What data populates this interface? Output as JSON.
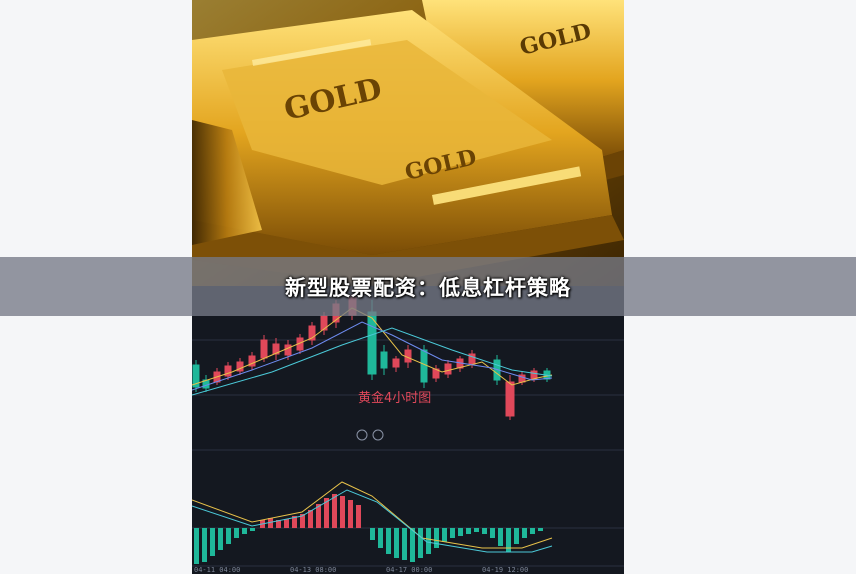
{
  "article": {
    "title": "新型股票配资：低息杠杆策略"
  },
  "image": {
    "bar_top_text": "GOLD",
    "bar_top_text_2": "GOLD",
    "bar_mid_text": "GOLD",
    "chart_caption": "黄金4小时图",
    "time_labels": [
      "04-11 04:00",
      "04-13 08:00",
      "04-17 00:00",
      "04-19 12:00"
    ]
  },
  "colors": {
    "band": "#767a86",
    "up": "#e0485a",
    "down": "#1fb89a",
    "gold": "#d9a21c",
    "chart_bg": "#141820"
  }
}
